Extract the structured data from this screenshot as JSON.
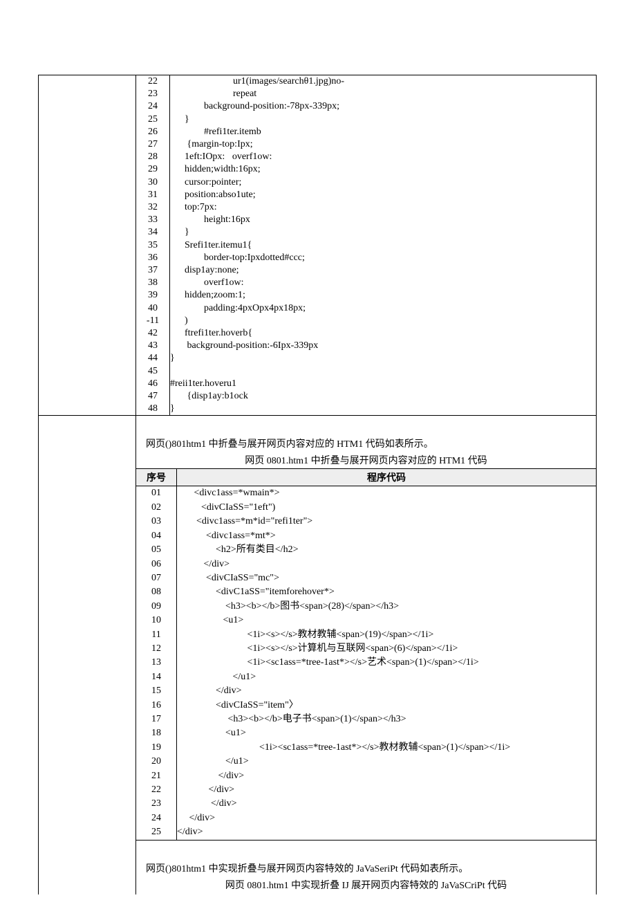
{
  "table1": {
    "rows": [
      {
        "n": "22",
        "c": "                          ur1(images/searchθ1.jpg)no-"
      },
      {
        "n": "23",
        "c": "                          repeat"
      },
      {
        "n": "24",
        "c": "              background-position:-78px-339px;"
      },
      {
        "n": "25",
        "c": "      }"
      },
      {
        "n": "26",
        "c": "              #refi1ter.itemb"
      },
      {
        "n": "27",
        "c": "       {margin-top:Ipx;"
      },
      {
        "n": "28",
        "c": "      1eft:IOpx:   overf1ow:"
      },
      {
        "n": "29",
        "c": "      hidden;width:16px;"
      },
      {
        "n": "30",
        "c": "      cursor:pointer;"
      },
      {
        "n": "31",
        "c": "      position:abso1ute;"
      },
      {
        "n": "32",
        "c": "      top:7px:"
      },
      {
        "n": "33",
        "c": "              height:16px"
      },
      {
        "n": "34",
        "c": "      }"
      },
      {
        "n": "35",
        "c": "      Srefi1ter.itemu1{"
      },
      {
        "n": "36",
        "c": "              border-top:Ipxdotted#ccc;"
      },
      {
        "n": "37",
        "c": "      disp1ay:none;"
      },
      {
        "n": "38",
        "c": "              overf1ow:"
      },
      {
        "n": "39",
        "c": "      hidden;zoom:1;"
      },
      {
        "n": "40",
        "c": "              padding:4pxOpx4px18px;"
      },
      {
        "n": "-11",
        "c": "      )"
      },
      {
        "n": "42",
        "c": "      ftrefi1ter.hoverb{"
      },
      {
        "n": "43",
        "c": "       background-position:-6Ipx-339px"
      },
      {
        "n": "44",
        "c": "}"
      },
      {
        "n": "45",
        "c": ""
      },
      {
        "n": "46",
        "c": "#reii1ter.hoveru1"
      },
      {
        "n": "47",
        "c": "       {disp1ay:b1ock"
      },
      {
        "n": "48",
        "c": "}"
      }
    ]
  },
  "para1": "网页()801htm1 中折叠与展开网页内容对应的 HTM1 代码如表所示。",
  "table2_title": "网页 0801.htm1 中折叠与展开网页内容对应的 HTM1 代码",
  "table2_head": {
    "col1": "序号",
    "col2": "程序代码"
  },
  "table2": {
    "rows": [
      {
        "n": "01",
        "c": "       <divc1ass=*wmain*>"
      },
      {
        "n": "02",
        "c": "          <divCIaSS=\"1eft\")"
      },
      {
        "n": "03",
        "c": "        <divc1ass=*m*id=\"refi1ter\">"
      },
      {
        "n": "04",
        "c": "            <divc1ass=*mt*>"
      },
      {
        "n": "05",
        "c": "                <h2>所有类目</h2>"
      },
      {
        "n": "06",
        "c": "           </div>"
      },
      {
        "n": "07",
        "c": "            <divCIaSS=\"mc\">"
      },
      {
        "n": "08",
        "c": "                <divC1aSS=\"itemforehover*>"
      },
      {
        "n": "09",
        "c": "                    <h3><b></b>图书<span>(28)</span></h3>"
      },
      {
        "n": "10",
        "c": "                   <u1>"
      },
      {
        "n": "11",
        "c": "                             <1i><s></s>教材教辅<span>(19)</span></1i>"
      },
      {
        "n": "12",
        "c": "                             <1i><s></s>计算机与互联网<span>(6)</span></1i>"
      },
      {
        "n": "13",
        "c": "                             <1i><sc1ass=*tree-1ast*></s>艺术<span>(1)</span></1i>"
      },
      {
        "n": "14",
        "c": "                       </u1>"
      },
      {
        "n": "15",
        "c": "                </div>"
      },
      {
        "n": "16",
        "c": "                <divCIaSS=\"item\"〉"
      },
      {
        "n": "17",
        "c": "                     <h3><b></b>电子书<span>(1)</span></h3>"
      },
      {
        "n": "18",
        "c": "                    <u1>"
      },
      {
        "n": "19",
        "c": "                                  <1i><sc1ass=*tree-1ast*></s>教材教辅<span>(1)</span></1i>"
      },
      {
        "n": "20",
        "c": "                    </u1>"
      },
      {
        "n": "21",
        "c": "                 </div>"
      },
      {
        "n": "22",
        "c": "             </div>"
      },
      {
        "n": "23",
        "c": "              </div>"
      },
      {
        "n": "24",
        "c": "     </div>"
      },
      {
        "n": "25",
        "c": "</div>"
      }
    ]
  },
  "para2": "网页()801htm1 中实现折叠与展开网页内容特效的 JaVaSeriPt 代码如表所示。",
  "table3_title": "网页 0801.htm1 中实现折叠 IJ 展开网页内容特效的 JaVaSCriPt 代码"
}
